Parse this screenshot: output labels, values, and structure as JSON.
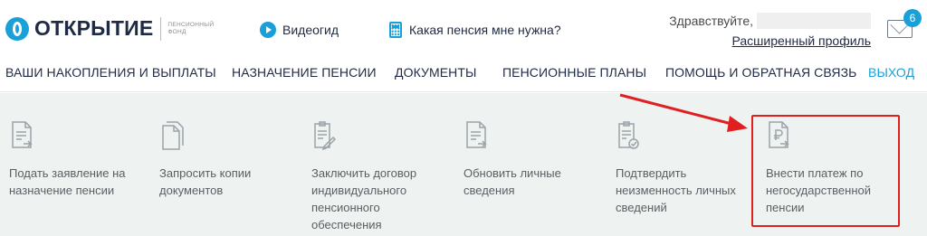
{
  "brand": {
    "name": "ОТКРЫТИЕ",
    "sub_line1": "ПЕНСИОННЫЙ",
    "sub_line2": "ФОНД"
  },
  "header": {
    "video_link": "Видеогид",
    "pension_link": "Какая пенсия мне нужна?",
    "greeting": "Здравствуйте,",
    "profile_link": "Расширенный профиль",
    "messages_count": "6"
  },
  "nav": {
    "items": [
      "ВАШИ НАКОПЛЕНИЯ И ВЫПЛАТЫ",
      "НАЗНАЧЕНИЕ ПЕНСИИ",
      "ДОКУМЕНТЫ",
      "ПЕНСИОННЫЕ ПЛАНЫ",
      "ПОМОЩЬ И ОБРАТНАЯ СВЯЗЬ"
    ],
    "exit": "ВЫХОД"
  },
  "actions": [
    {
      "label": "Подать заявление на назначение пенсии",
      "icon": "document-arrow-icon"
    },
    {
      "label": "Запросить копии документов",
      "icon": "documents-copy-icon"
    },
    {
      "label": "Заключить договор индивидуального пенсионного обеспечения",
      "icon": "contract-pen-icon"
    },
    {
      "label": "Обновить личные сведения",
      "icon": "document-arrow-icon"
    },
    {
      "label": "Подтвердить неизменность личных сведений",
      "icon": "document-check-icon"
    },
    {
      "label": "Внести платеж по негосударственной пенсии",
      "icon": "ruble-document-icon"
    }
  ],
  "colors": {
    "accent": "#1aa0d8",
    "highlight": "#e02020",
    "panel_bg": "#eef3f2"
  }
}
